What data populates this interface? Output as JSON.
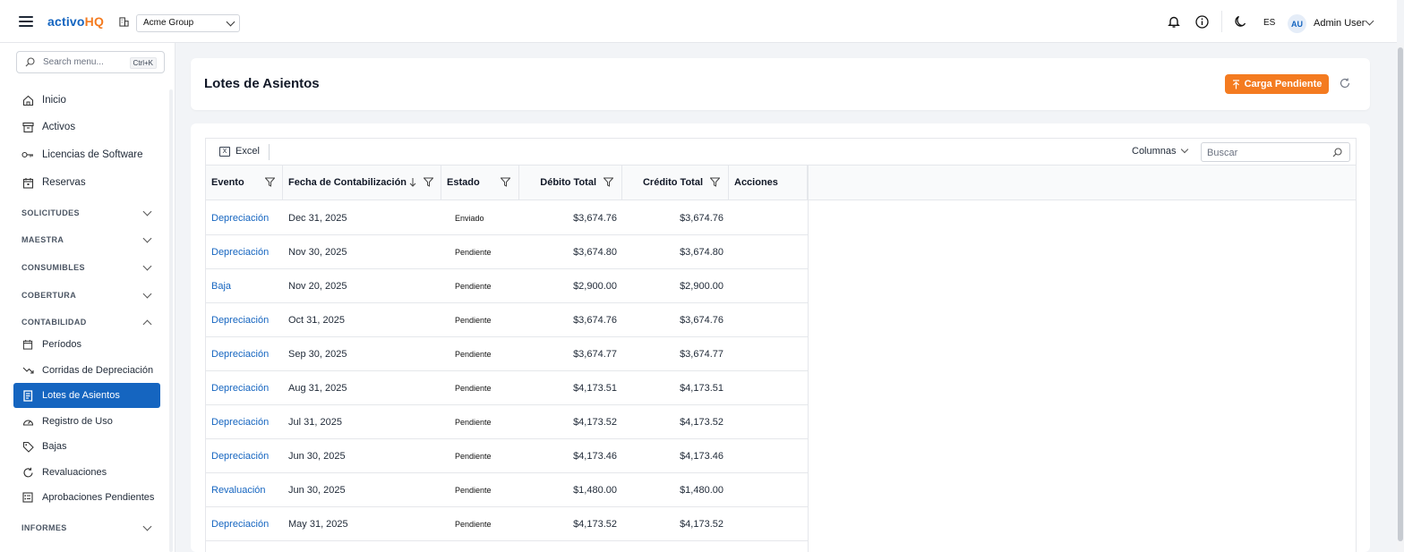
{
  "app": {
    "logo_main": "activo",
    "logo_accent": "HQ",
    "org": "Acme Group",
    "lang": "ES",
    "user_initials": "AU",
    "user_name": "Admin User"
  },
  "sidebar": {
    "search_placeholder": "Search menu...",
    "shortcut": "Ctrl+K",
    "top_items": [
      {
        "label": "Inicio",
        "icon": "home-icon"
      },
      {
        "label": "Activos",
        "icon": "archive-icon"
      },
      {
        "label": "Licencias de Software",
        "icon": "key-icon"
      },
      {
        "label": "Reservas",
        "icon": "calendar-icon"
      }
    ],
    "sections": [
      {
        "label": "SOLICITUDES",
        "expanded": false
      },
      {
        "label": "MAESTRA",
        "expanded": false
      },
      {
        "label": "CONSUMIBLES",
        "expanded": false
      },
      {
        "label": "COBERTURA",
        "expanded": false
      },
      {
        "label": "CONTABILIDAD",
        "expanded": true
      },
      {
        "label": "INFORMES",
        "expanded": false
      }
    ],
    "accounting_items": [
      {
        "label": "Períodos",
        "icon": "calendar-icon"
      },
      {
        "label": "Corridas de Depreciación",
        "icon": "trend-down-icon"
      },
      {
        "label": "Lotes de Asientos",
        "icon": "ledger-icon",
        "active": true
      },
      {
        "label": "Registro de Uso",
        "icon": "gauge-icon"
      },
      {
        "label": "Bajas",
        "icon": "tag-icon"
      },
      {
        "label": "Revaluaciones",
        "icon": "refresh-icon"
      },
      {
        "label": "Aprobaciones Pendientes",
        "icon": "checklist-icon"
      }
    ]
  },
  "main": {
    "title": "Lotes de Asientos",
    "upload_button": "Carga Pendiente",
    "toolbar": {
      "excel": "Excel",
      "columns": "Columnas",
      "search_placeholder": "Buscar"
    },
    "columns": [
      "Evento",
      "Fecha de Contabilización",
      "Estado",
      "Débito Total",
      "Crédito Total",
      "Acciones"
    ],
    "rows": [
      {
        "evento": "Depreciación",
        "fecha": "Dec 31, 2025",
        "estado": "Enviado",
        "debito": "$3,674.76",
        "credito": "$3,674.76"
      },
      {
        "evento": "Depreciación",
        "fecha": "Nov 30, 2025",
        "estado": "Pendiente",
        "debito": "$3,674.80",
        "credito": "$3,674.80"
      },
      {
        "evento": "Baja",
        "fecha": "Nov 20, 2025",
        "estado": "Pendiente",
        "debito": "$2,900.00",
        "credito": "$2,900.00"
      },
      {
        "evento": "Depreciación",
        "fecha": "Oct 31, 2025",
        "estado": "Pendiente",
        "debito": "$3,674.76",
        "credito": "$3,674.76"
      },
      {
        "evento": "Depreciación",
        "fecha": "Sep 30, 2025",
        "estado": "Pendiente",
        "debito": "$3,674.77",
        "credito": "$3,674.77"
      },
      {
        "evento": "Depreciación",
        "fecha": "Aug 31, 2025",
        "estado": "Pendiente",
        "debito": "$4,173.51",
        "credito": "$4,173.51"
      },
      {
        "evento": "Depreciación",
        "fecha": "Jul 31, 2025",
        "estado": "Pendiente",
        "debito": "$4,173.52",
        "credito": "$4,173.52"
      },
      {
        "evento": "Depreciación",
        "fecha": "Jun 30, 2025",
        "estado": "Pendiente",
        "debito": "$4,173.46",
        "credito": "$4,173.46"
      },
      {
        "evento": "Revaluación",
        "fecha": "Jun 30, 2025",
        "estado": "Pendiente",
        "debito": "$1,480.00",
        "credito": "$1,480.00"
      },
      {
        "evento": "Depreciación",
        "fecha": "May 31, 2025",
        "estado": "Pendiente",
        "debito": "$4,173.52",
        "credito": "$4,173.52"
      }
    ]
  },
  "colors": {
    "primary": "#1565c0",
    "accent": "#f47b20"
  }
}
